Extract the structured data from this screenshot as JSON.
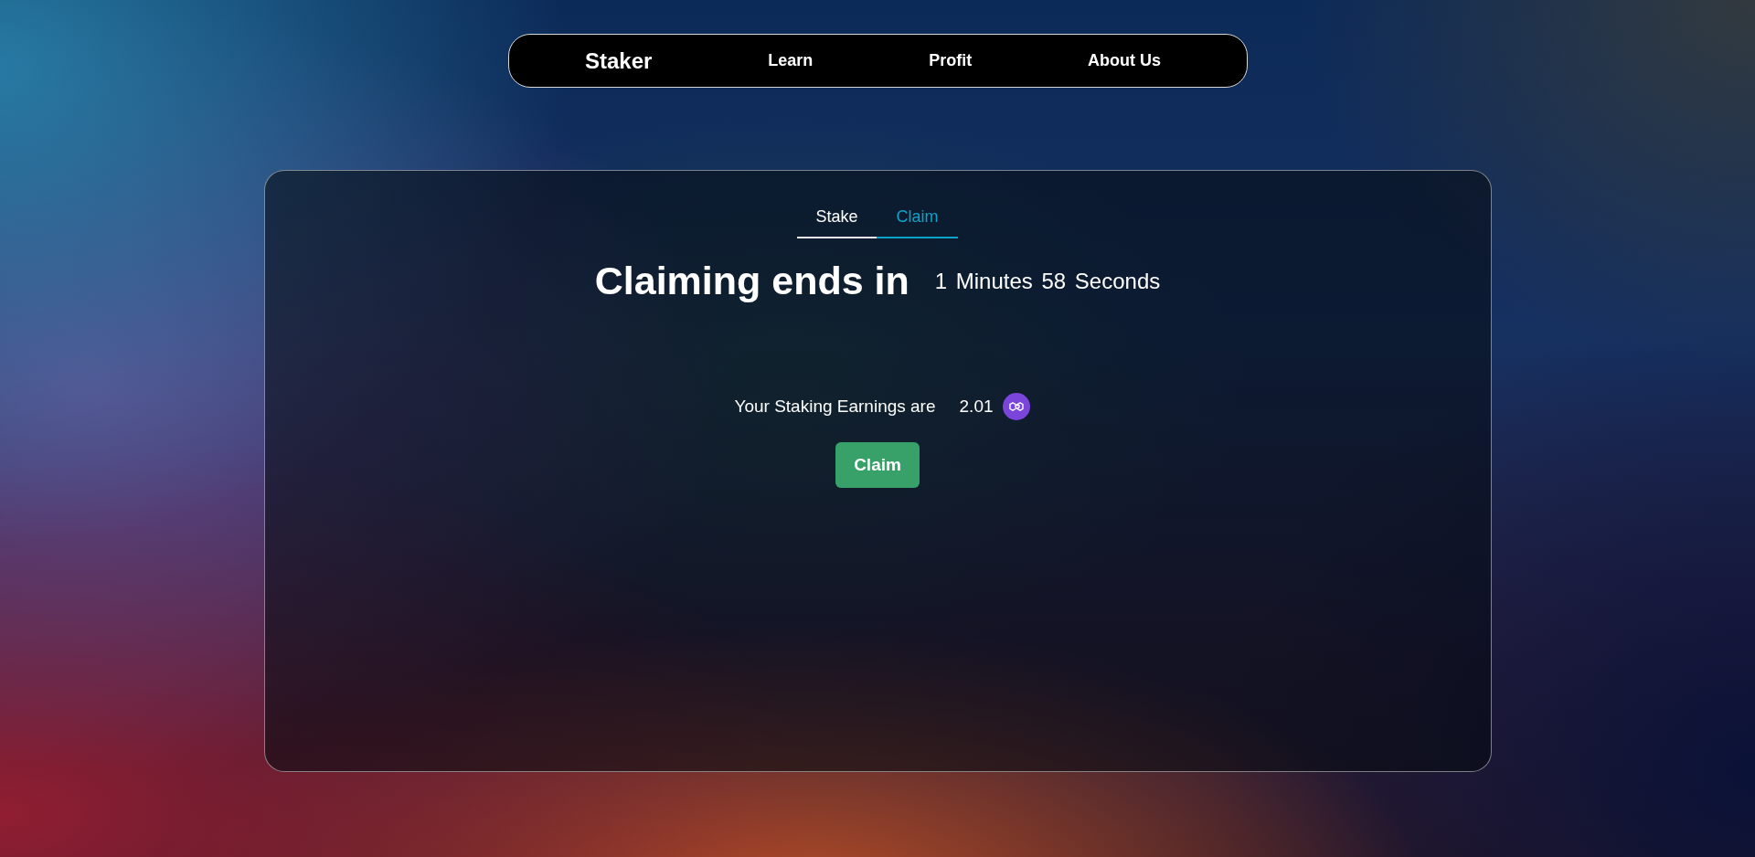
{
  "nav": {
    "brand": "Staker",
    "links": [
      "Learn",
      "Profit",
      "About Us"
    ]
  },
  "tabs": [
    {
      "label": "Stake",
      "selected": false
    },
    {
      "label": "Claim",
      "selected": true
    }
  ],
  "countdown": {
    "heading": "Claiming ends in",
    "remaining": "1 Minutes 58 Seconds"
  },
  "earnings": {
    "label": "Your Staking Earnings are",
    "amount": "2.01"
  },
  "claim_button": {
    "label": "Claim"
  }
}
